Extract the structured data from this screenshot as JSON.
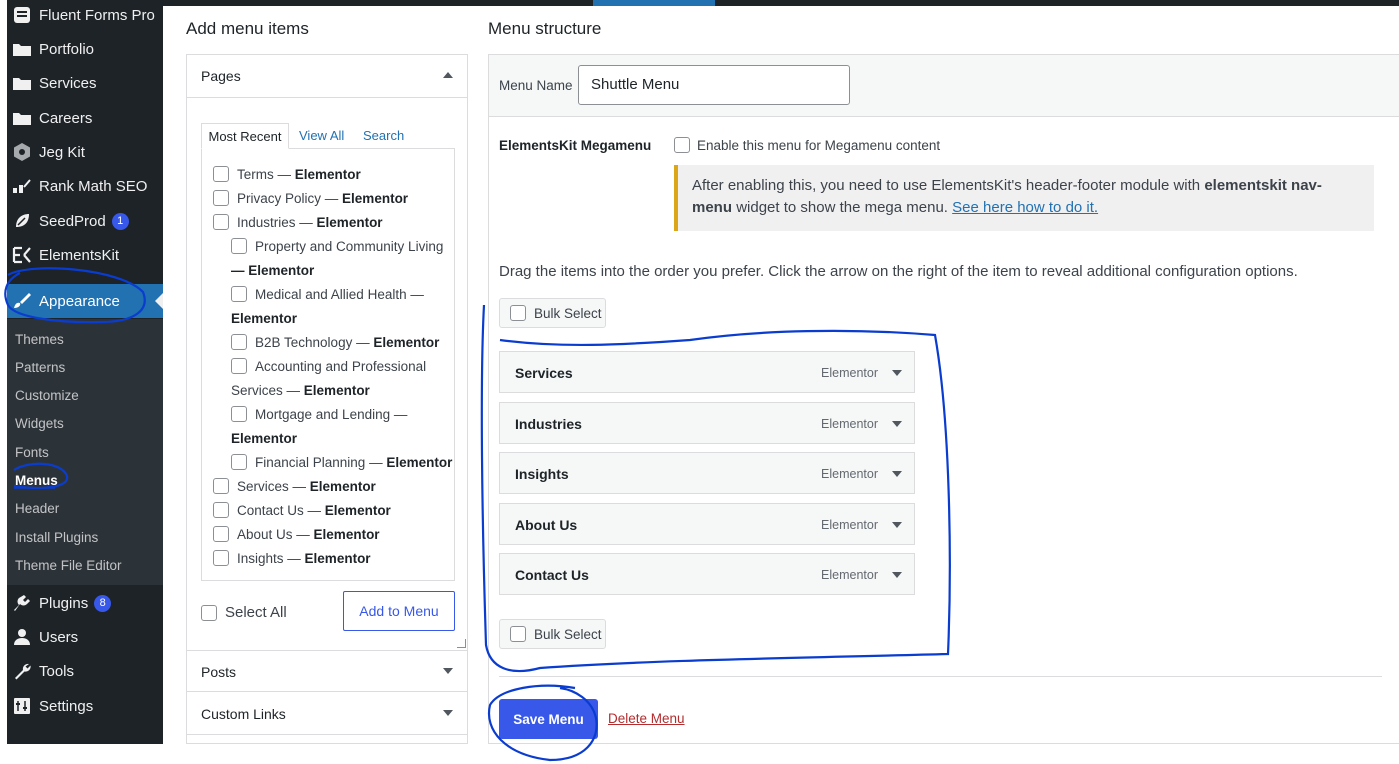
{
  "sidebar": {
    "items": [
      {
        "label": "Fluent Forms Pro",
        "icon": "form-icon"
      },
      {
        "label": "Portfolio",
        "icon": "folder-icon"
      },
      {
        "label": "Services",
        "icon": "folder-icon"
      },
      {
        "label": "Careers",
        "icon": "folder-icon"
      },
      {
        "label": "Jeg Kit",
        "icon": "hexagon-icon"
      },
      {
        "label": "Rank Math SEO",
        "icon": "chart-icon"
      },
      {
        "label": "SeedProd",
        "icon": "leaf-icon",
        "badge": "1"
      },
      {
        "label": "ElementsKit",
        "icon": "ek-icon"
      },
      {
        "label": "Appearance",
        "icon": "paintbrush-icon"
      }
    ],
    "submenu": [
      "Themes",
      "Patterns",
      "Customize",
      "Widgets",
      "Fonts",
      "Menus",
      "Header",
      "Install Plugins",
      "Theme File Editor"
    ],
    "bottom_items": [
      {
        "label": "Plugins",
        "icon": "plugin-icon",
        "badge": "8"
      },
      {
        "label": "Users",
        "icon": "user-icon"
      },
      {
        "label": "Tools",
        "icon": "wrench-icon"
      },
      {
        "label": "Settings",
        "icon": "settings-icon"
      }
    ]
  },
  "add_items": {
    "heading": "Add menu items",
    "pages": {
      "title": "Pages",
      "tabs": [
        "Most Recent",
        "View All",
        "Search"
      ],
      "list": [
        {
          "pre": "Terms —",
          "b": "Elementor"
        },
        {
          "pre": "Privacy Policy —",
          "b": "Elementor"
        },
        {
          "pre": "Industries —",
          "b": "Elementor"
        },
        {
          "pre": "Property and Community Living",
          "cont_b": "— Elementor"
        },
        {
          "pre": "Medical and Allied Health —",
          "cont_b": "Elementor"
        },
        {
          "pre": "B2B Technology —",
          "b": "Elementor"
        },
        {
          "pre": "Accounting and Professional",
          "cont": "Services —",
          "cont_b": "Elementor"
        },
        {
          "pre": "Mortgage and Lending —",
          "cont_b": "Elementor"
        },
        {
          "pre": "Financial Planning —",
          "b": "Elementor"
        },
        {
          "pre": "Services —",
          "b": "Elementor"
        },
        {
          "pre": "Contact Us —",
          "b": "Elementor"
        },
        {
          "pre": "About Us —",
          "b": "Elementor"
        },
        {
          "pre": "Insights —",
          "b": "Elementor"
        }
      ],
      "select_all": "Select All",
      "add_button": "Add to Menu"
    },
    "posts": "Posts",
    "custom_links": "Custom Links"
  },
  "menu": {
    "heading": "Menu structure",
    "name_label": "Menu Name",
    "name_value": "Shuttle Menu",
    "megamenu_label": "ElementsKit Megamenu",
    "megamenu_checkbox": "Enable this menu for Megamenu content",
    "notice_text": "After enabling this, you need to use ElementsKit's header-footer module with",
    "notice_bold": "elementskit nav-menu",
    "notice_text2": "widget to show the mega menu.",
    "notice_link": "See here how to do it.",
    "instructions": "Drag the items into the order you prefer. Click the arrow on the right of the item to reveal additional configuration options.",
    "bulk_select": "Bulk Select",
    "items": [
      {
        "title": "Services",
        "type": "Elementor"
      },
      {
        "title": "Industries",
        "type": "Elementor"
      },
      {
        "title": "Insights",
        "type": "Elementor"
      },
      {
        "title": "About Us",
        "type": "Elementor"
      },
      {
        "title": "Contact Us",
        "type": "Elementor"
      }
    ],
    "save_button": "Save Menu",
    "delete_link": "Delete Menu"
  },
  "colors": {
    "sidebar_bg": "#1d2327",
    "accent": "#3858e9",
    "annotation_ink": "#0a3ccf",
    "notice_border": "#dba617",
    "delete": "#b32d2e"
  }
}
